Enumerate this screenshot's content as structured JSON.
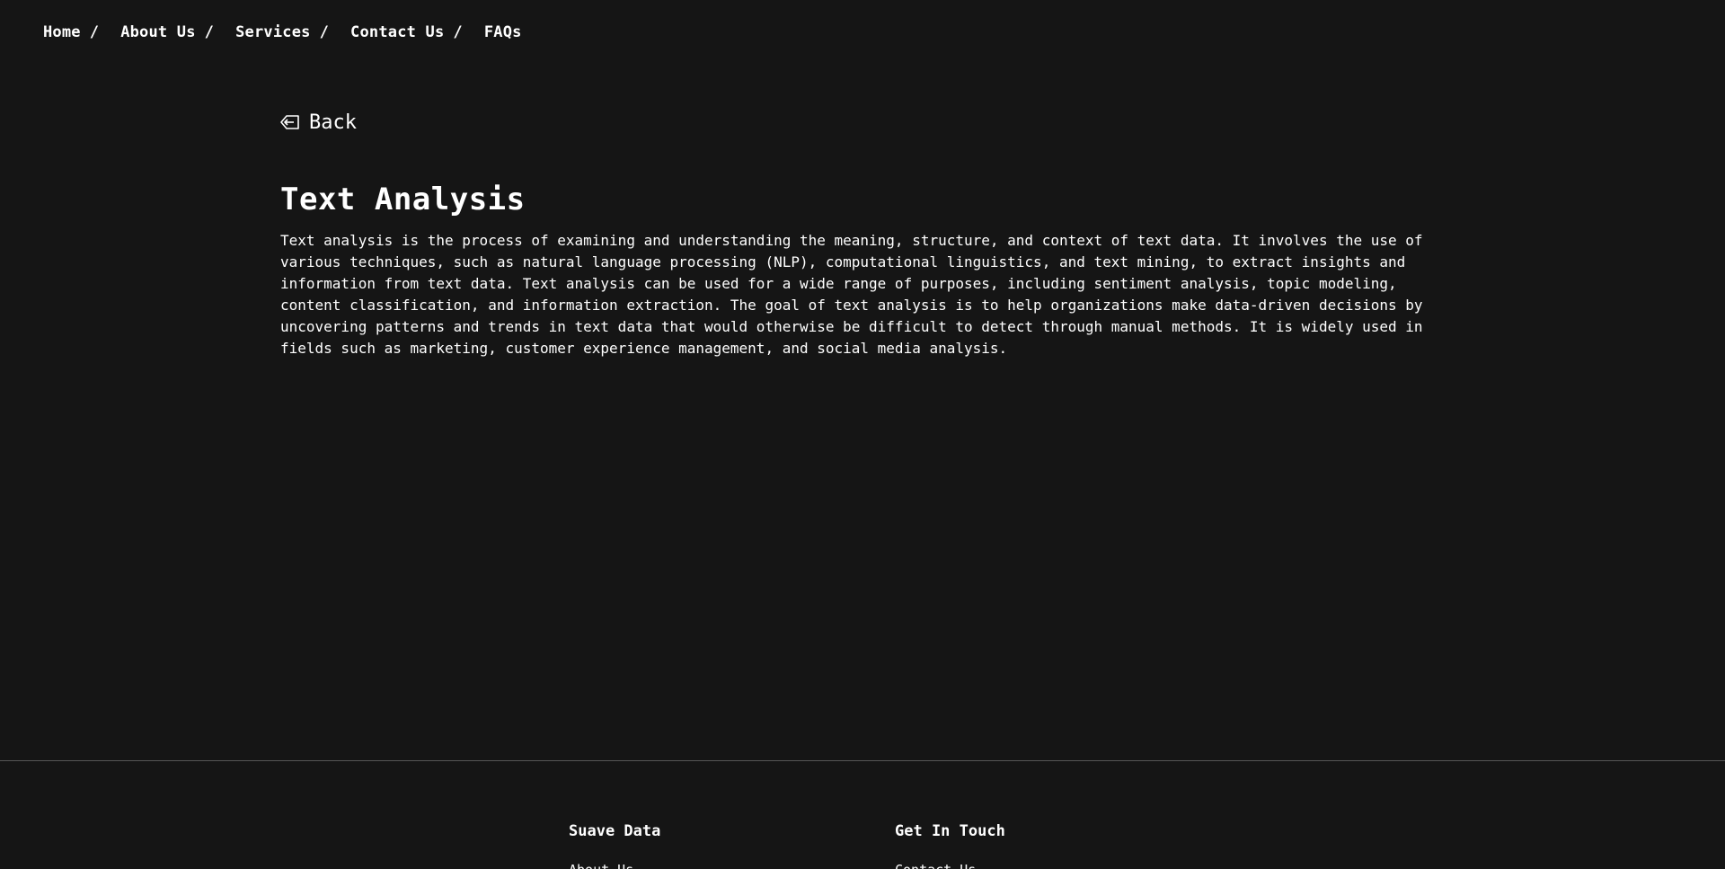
{
  "nav": {
    "items": [
      {
        "label": "Home",
        "sep": "/"
      },
      {
        "label": "About Us",
        "sep": "/"
      },
      {
        "label": "Services",
        "sep": "/"
      },
      {
        "label": "Contact Us",
        "sep": "/"
      },
      {
        "label": "FAQs",
        "sep": ""
      }
    ]
  },
  "back": {
    "label": "Back",
    "icon": "back-arrow-icon"
  },
  "article": {
    "title": "Text Analysis",
    "body": "Text analysis is the process of examining and understanding the meaning, structure, and context of text data. It involves the use of various techniques, such as natural language processing (NLP), computational linguistics, and text mining, to extract insights and information from text data. Text analysis can be used for a wide range of purposes, including sentiment analysis, topic modeling, content classification, and information extraction. The goal of text analysis is to help organizations make data-driven decisions by uncovering patterns and trends in text data that would otherwise be difficult to detect through manual methods. It is widely used in fields such as marketing, customer experience management, and social media analysis."
  },
  "footer": {
    "col1": {
      "heading": "Suave Data",
      "link": "About Us"
    },
    "col2": {
      "heading": "Get In Touch",
      "link": "Contact Us"
    }
  },
  "colors": {
    "background": "#151515",
    "text": "#ffffff",
    "divider": "#555555"
  }
}
